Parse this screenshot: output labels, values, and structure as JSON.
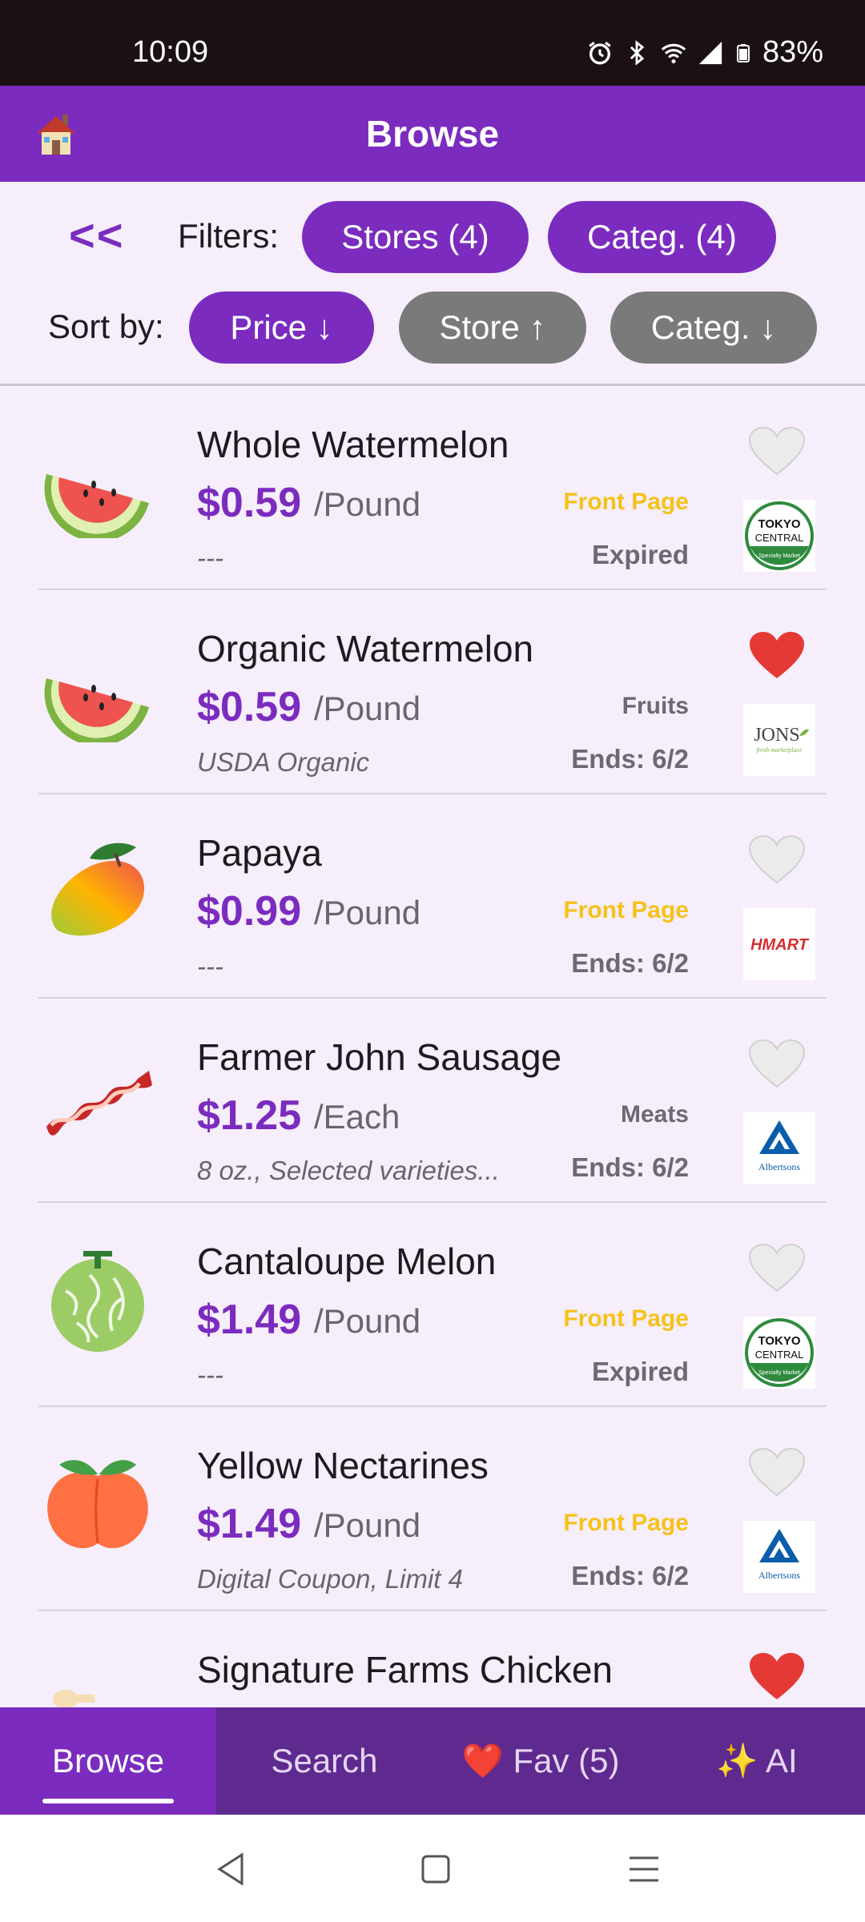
{
  "status": {
    "time": "10:09",
    "battery": "83%"
  },
  "appbar": {
    "title": "Browse"
  },
  "filters": {
    "back_label": "<<",
    "filters_label": "Filters:",
    "stores_label": "Stores (4)",
    "categ_label": "Categ. (4)",
    "sort_label": "Sort by:",
    "sort_price": "Price ↓",
    "sort_store": "Store ↑",
    "sort_categ": "Categ. ↓"
  },
  "items": [
    {
      "name": "Whole Watermelon",
      "price": "$0.59",
      "unit": "/Pound",
      "note": "---",
      "category": "Front Page",
      "category_style": "yellow",
      "ends": "Expired",
      "favorite": false,
      "icon": "watermelon-icon",
      "store": "TOKYO CENTRAL"
    },
    {
      "name": "Organic Watermelon",
      "price": "$0.59",
      "unit": "/Pound",
      "note": "USDA Organic",
      "category": "Fruits",
      "category_style": "gray",
      "ends": "Ends: 6/2",
      "favorite": true,
      "icon": "watermelon-icon",
      "store": "JONS"
    },
    {
      "name": "Papaya",
      "price": "$0.99",
      "unit": "/Pound",
      "note": "---",
      "category": "Front Page",
      "category_style": "yellow",
      "ends": "Ends: 6/2",
      "favorite": false,
      "icon": "mango-icon",
      "store": "HMART"
    },
    {
      "name": "Farmer John Sausage",
      "price": "$1.25",
      "unit": "/Each",
      "note": "8 oz., Selected varieties...",
      "category": "Meats",
      "category_style": "gray",
      "ends": "Ends: 6/2",
      "favorite": false,
      "icon": "bacon-icon",
      "store": "Albertsons"
    },
    {
      "name": "Cantaloupe Melon",
      "price": "$1.49",
      "unit": "/Pound",
      "note": "---",
      "category": "Front Page",
      "category_style": "yellow",
      "ends": "Expired",
      "favorite": false,
      "icon": "melon-icon",
      "store": "TOKYO CENTRAL"
    },
    {
      "name": "Yellow Nectarines",
      "price": "$1.49",
      "unit": "/Pound",
      "note": "Digital Coupon, Limit 4",
      "category": "Front Page",
      "category_style": "yellow",
      "ends": "Ends: 6/2",
      "favorite": false,
      "icon": "peach-icon",
      "store": "Albertsons"
    },
    {
      "name": "Signature Farms Chicken",
      "price": "",
      "unit": "",
      "note": "",
      "category": "",
      "category_style": "gray",
      "ends": "",
      "favorite": true,
      "icon": "chicken-icon",
      "store": ""
    }
  ],
  "logos": {
    "tokyo_top": "TOKYO",
    "tokyo_bottom": "CENTRAL",
    "tokyo_sub": "Specialty Market",
    "jons": "JONS",
    "jons_sub": "fresh marketplace",
    "hmart": "HMART",
    "albertsons": "Albertsons"
  },
  "bottomnav": {
    "browse": "Browse",
    "search": "Search",
    "fav": "❤️ Fav (5)",
    "ai": "✨ AI"
  },
  "colors": {
    "primary": "#7b2cbf",
    "nav": "#5f2a8f",
    "front_page": "#f5c21b"
  }
}
